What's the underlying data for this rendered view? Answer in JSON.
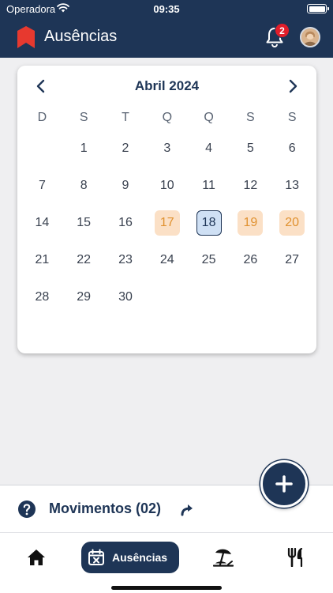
{
  "status_bar": {
    "carrier": "Operadora",
    "time": "09:35"
  },
  "app_bar": {
    "title": "Ausências",
    "notification_count": "2",
    "logo_icon": "bookmark-logo-icon",
    "brand_color": "#1e3556",
    "accent_color": "#e7392f"
  },
  "calendar": {
    "month_title": "Abril 2024",
    "weekdays": [
      "D",
      "S",
      "T",
      "Q",
      "Q",
      "S",
      "S"
    ],
    "weeks": [
      [
        "",
        "1",
        "2",
        "3",
        "4",
        "5",
        "6"
      ],
      [
        "7",
        "8",
        "9",
        "10",
        "11",
        "12",
        "13"
      ],
      [
        "14",
        "15",
        "16",
        "17",
        "18",
        "19",
        "20"
      ],
      [
        "21",
        "22",
        "23",
        "24",
        "25",
        "26",
        "27"
      ],
      [
        "28",
        "29",
        "30",
        "",
        "",
        "",
        ""
      ]
    ],
    "today": "18",
    "vacation_days": [
      "17",
      "19",
      "20"
    ],
    "vacation_color": "#e0912f",
    "today_color": "#cfe0f4"
  },
  "movimentos": {
    "label": "Movimentos (02)"
  },
  "tabs": {
    "home_icon": "home-icon",
    "ausencias_label": "Ausências",
    "beach_icon": "beach-umbrella-icon",
    "food_icon": "fork-knife-icon"
  }
}
